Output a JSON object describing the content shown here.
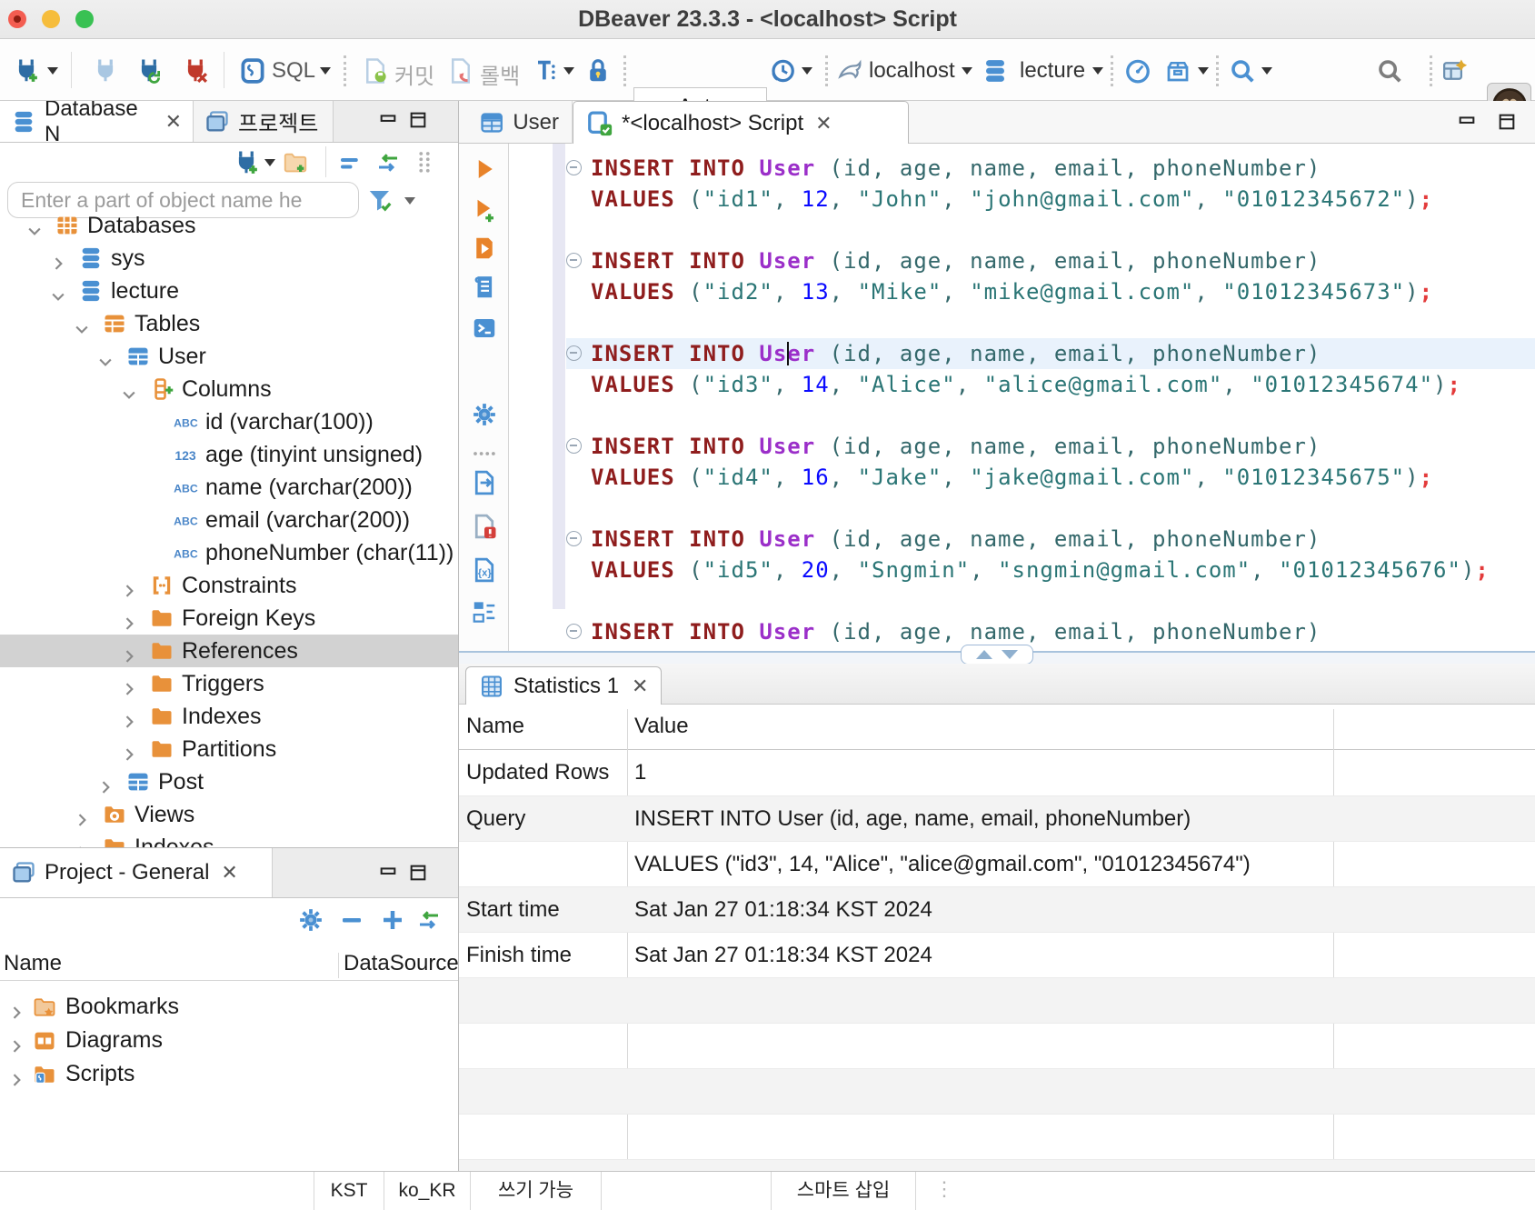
{
  "window": {
    "title": "DBeaver 23.3.3 - <localhost> Script"
  },
  "toolbar": {
    "sql_label": "SQL",
    "commit_label": "커밋",
    "rollback_label": "롤백",
    "auto_value": "Auto",
    "connection": "localhost",
    "database": "lecture"
  },
  "navigator": {
    "tab_database": "Database N",
    "tab_project": "프로젝트",
    "filter_placeholder": "Enter a part of object name he",
    "tree": [
      {
        "label": "Databases",
        "type": "dbgroup",
        "level": 0,
        "chevron": "down"
      },
      {
        "label": "sys",
        "type": "database",
        "level": 1,
        "chevron": "right"
      },
      {
        "label": "lecture",
        "type": "database",
        "level": 1,
        "chevron": "down"
      },
      {
        "label": "Tables",
        "type": "tables",
        "level": 2,
        "chevron": "down"
      },
      {
        "label": "User",
        "type": "table",
        "level": 3,
        "chevron": "down"
      },
      {
        "label": "Columns",
        "type": "columns",
        "level": 4,
        "chevron": "down"
      },
      {
        "label": "id (varchar(100))",
        "type": "abc",
        "level": 5,
        "chevron": "none"
      },
      {
        "label": "age (tinyint unsigned)",
        "type": "num",
        "level": 5,
        "chevron": "none"
      },
      {
        "label": "name (varchar(200))",
        "type": "abc",
        "level": 5,
        "chevron": "none"
      },
      {
        "label": "email (varchar(200))",
        "type": "abc",
        "level": 5,
        "chevron": "none"
      },
      {
        "label": "phoneNumber (char(11))",
        "type": "abc",
        "level": 5,
        "chevron": "none"
      },
      {
        "label": "Constraints",
        "type": "constraints",
        "level": 4,
        "chevron": "right"
      },
      {
        "label": "Foreign Keys",
        "type": "folder",
        "level": 4,
        "chevron": "right"
      },
      {
        "label": "References",
        "type": "folder",
        "level": 4,
        "chevron": "right",
        "selected": true
      },
      {
        "label": "Triggers",
        "type": "folder",
        "level": 4,
        "chevron": "right"
      },
      {
        "label": "Indexes",
        "type": "folder",
        "level": 4,
        "chevron": "right"
      },
      {
        "label": "Partitions",
        "type": "folder",
        "level": 4,
        "chevron": "right"
      },
      {
        "label": "Post",
        "type": "table",
        "level": 3,
        "chevron": "right"
      },
      {
        "label": "Views",
        "type": "views",
        "level": 2,
        "chevron": "right"
      },
      {
        "label": "Indexes",
        "type": "folder",
        "level": 2,
        "chevron": "right"
      }
    ]
  },
  "project_panel": {
    "tab": "Project - General",
    "col_name": "Name",
    "col_datasource": "DataSource",
    "items": [
      {
        "label": "Bookmarks",
        "type": "folderstar"
      },
      {
        "label": "Diagrams",
        "type": "diagrams"
      },
      {
        "label": "Scripts",
        "type": "scriptsfolder"
      }
    ]
  },
  "editor": {
    "tab_user": "User",
    "tab_script": "*<localhost> Script",
    "sql": {
      "insert_clause": "INSERT INTO",
      "table_name": "User",
      "column_list": "(id, age, name, email, phoneNumber)",
      "values_keyword": "VALUES"
    },
    "statements": [
      {
        "id": "id1",
        "age": "12",
        "person": "John",
        "email": "john@gmail.com",
        "phone": "01012345672"
      },
      {
        "id": "id2",
        "age": "13",
        "person": "Mike",
        "email": "mike@gmail.com",
        "phone": "01012345673"
      },
      {
        "id": "id3",
        "age": "14",
        "person": "Alice",
        "email": "alice@gmail.com",
        "phone": "01012345674",
        "current": true
      },
      {
        "id": "id4",
        "age": "16",
        "person": "Jake",
        "email": "jake@gmail.com",
        "phone": "01012345675"
      },
      {
        "id": "id5",
        "age": "20",
        "person": "Sngmin",
        "email": "sngmin@gmail.com",
        "phone": "01012345676"
      }
    ],
    "trailing_statement": true
  },
  "statistics": {
    "tab": "Statistics 1",
    "col_name": "Name",
    "col_value": "Value",
    "rows": [
      {
        "name": "Updated Rows",
        "value": "1"
      },
      {
        "name": "Query",
        "value": "INSERT INTO User (id, age, name, email, phoneNumber)"
      },
      {
        "name": "",
        "value": "VALUES (\"id3\", 14, \"Alice\", \"alice@gmail.com\", \"01012345674\")"
      },
      {
        "name": "Start time",
        "value": "Sat Jan 27 01:18:34 KST 2024"
      },
      {
        "name": "Finish time",
        "value": "Sat Jan 27 01:18:34 KST 2024"
      },
      {
        "name": "",
        "value": ""
      },
      {
        "name": "",
        "value": ""
      },
      {
        "name": "",
        "value": ""
      },
      {
        "name": "",
        "value": ""
      },
      {
        "name": "",
        "value": ""
      }
    ]
  },
  "status_bar": {
    "timezone": "KST",
    "locale": "ko_KR",
    "write_mode": "쓰기 가능",
    "insert_mode": "스마트 삽입"
  },
  "colors": {
    "accent_blue": "#4a90d2",
    "accent_orange": "#e8913a",
    "keyword": "#8f1d1d",
    "table_name": "#9b2fc9",
    "identifier": "#34686b",
    "string": "#2a7575",
    "number": "#0a0aff",
    "semicolon": "#e33b3b",
    "current_line": "#e9f2fc",
    "selection_gray": "#d2d2d2"
  }
}
